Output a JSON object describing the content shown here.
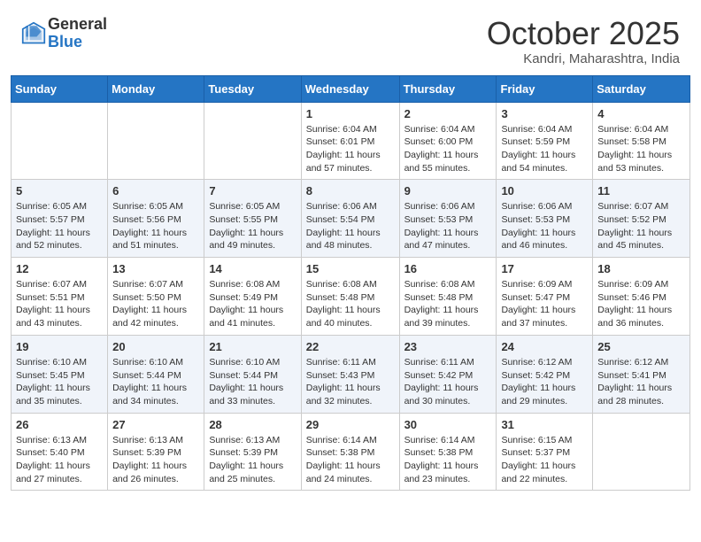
{
  "header": {
    "logo_general": "General",
    "logo_blue": "Blue",
    "month": "October 2025",
    "location": "Kandri, Maharashtra, India"
  },
  "days_of_week": [
    "Sunday",
    "Monday",
    "Tuesday",
    "Wednesday",
    "Thursday",
    "Friday",
    "Saturday"
  ],
  "weeks": [
    [
      {
        "day": "",
        "text": ""
      },
      {
        "day": "",
        "text": ""
      },
      {
        "day": "",
        "text": ""
      },
      {
        "day": "1",
        "text": "Sunrise: 6:04 AM\nSunset: 6:01 PM\nDaylight: 11 hours\nand 57 minutes."
      },
      {
        "day": "2",
        "text": "Sunrise: 6:04 AM\nSunset: 6:00 PM\nDaylight: 11 hours\nand 55 minutes."
      },
      {
        "day": "3",
        "text": "Sunrise: 6:04 AM\nSunset: 5:59 PM\nDaylight: 11 hours\nand 54 minutes."
      },
      {
        "day": "4",
        "text": "Sunrise: 6:04 AM\nSunset: 5:58 PM\nDaylight: 11 hours\nand 53 minutes."
      }
    ],
    [
      {
        "day": "5",
        "text": "Sunrise: 6:05 AM\nSunset: 5:57 PM\nDaylight: 11 hours\nand 52 minutes."
      },
      {
        "day": "6",
        "text": "Sunrise: 6:05 AM\nSunset: 5:56 PM\nDaylight: 11 hours\nand 51 minutes."
      },
      {
        "day": "7",
        "text": "Sunrise: 6:05 AM\nSunset: 5:55 PM\nDaylight: 11 hours\nand 49 minutes."
      },
      {
        "day": "8",
        "text": "Sunrise: 6:06 AM\nSunset: 5:54 PM\nDaylight: 11 hours\nand 48 minutes."
      },
      {
        "day": "9",
        "text": "Sunrise: 6:06 AM\nSunset: 5:53 PM\nDaylight: 11 hours\nand 47 minutes."
      },
      {
        "day": "10",
        "text": "Sunrise: 6:06 AM\nSunset: 5:53 PM\nDaylight: 11 hours\nand 46 minutes."
      },
      {
        "day": "11",
        "text": "Sunrise: 6:07 AM\nSunset: 5:52 PM\nDaylight: 11 hours\nand 45 minutes."
      }
    ],
    [
      {
        "day": "12",
        "text": "Sunrise: 6:07 AM\nSunset: 5:51 PM\nDaylight: 11 hours\nand 43 minutes."
      },
      {
        "day": "13",
        "text": "Sunrise: 6:07 AM\nSunset: 5:50 PM\nDaylight: 11 hours\nand 42 minutes."
      },
      {
        "day": "14",
        "text": "Sunrise: 6:08 AM\nSunset: 5:49 PM\nDaylight: 11 hours\nand 41 minutes."
      },
      {
        "day": "15",
        "text": "Sunrise: 6:08 AM\nSunset: 5:48 PM\nDaylight: 11 hours\nand 40 minutes."
      },
      {
        "day": "16",
        "text": "Sunrise: 6:08 AM\nSunset: 5:48 PM\nDaylight: 11 hours\nand 39 minutes."
      },
      {
        "day": "17",
        "text": "Sunrise: 6:09 AM\nSunset: 5:47 PM\nDaylight: 11 hours\nand 37 minutes."
      },
      {
        "day": "18",
        "text": "Sunrise: 6:09 AM\nSunset: 5:46 PM\nDaylight: 11 hours\nand 36 minutes."
      }
    ],
    [
      {
        "day": "19",
        "text": "Sunrise: 6:10 AM\nSunset: 5:45 PM\nDaylight: 11 hours\nand 35 minutes."
      },
      {
        "day": "20",
        "text": "Sunrise: 6:10 AM\nSunset: 5:44 PM\nDaylight: 11 hours\nand 34 minutes."
      },
      {
        "day": "21",
        "text": "Sunrise: 6:10 AM\nSunset: 5:44 PM\nDaylight: 11 hours\nand 33 minutes."
      },
      {
        "day": "22",
        "text": "Sunrise: 6:11 AM\nSunset: 5:43 PM\nDaylight: 11 hours\nand 32 minutes."
      },
      {
        "day": "23",
        "text": "Sunrise: 6:11 AM\nSunset: 5:42 PM\nDaylight: 11 hours\nand 30 minutes."
      },
      {
        "day": "24",
        "text": "Sunrise: 6:12 AM\nSunset: 5:42 PM\nDaylight: 11 hours\nand 29 minutes."
      },
      {
        "day": "25",
        "text": "Sunrise: 6:12 AM\nSunset: 5:41 PM\nDaylight: 11 hours\nand 28 minutes."
      }
    ],
    [
      {
        "day": "26",
        "text": "Sunrise: 6:13 AM\nSunset: 5:40 PM\nDaylight: 11 hours\nand 27 minutes."
      },
      {
        "day": "27",
        "text": "Sunrise: 6:13 AM\nSunset: 5:39 PM\nDaylight: 11 hours\nand 26 minutes."
      },
      {
        "day": "28",
        "text": "Sunrise: 6:13 AM\nSunset: 5:39 PM\nDaylight: 11 hours\nand 25 minutes."
      },
      {
        "day": "29",
        "text": "Sunrise: 6:14 AM\nSunset: 5:38 PM\nDaylight: 11 hours\nand 24 minutes."
      },
      {
        "day": "30",
        "text": "Sunrise: 6:14 AM\nSunset: 5:38 PM\nDaylight: 11 hours\nand 23 minutes."
      },
      {
        "day": "31",
        "text": "Sunrise: 6:15 AM\nSunset: 5:37 PM\nDaylight: 11 hours\nand 22 minutes."
      },
      {
        "day": "",
        "text": ""
      }
    ]
  ]
}
